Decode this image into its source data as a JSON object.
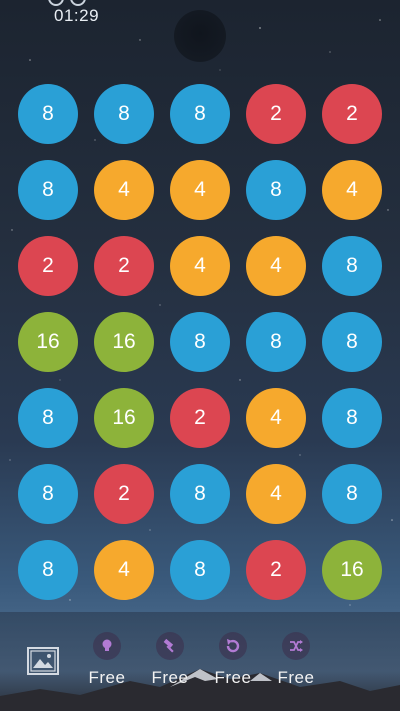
{
  "status": {
    "timer": "01:29"
  },
  "board": {
    "rows": [
      [
        8,
        8,
        8,
        2,
        2
      ],
      [
        8,
        4,
        4,
        8,
        4
      ],
      [
        2,
        2,
        4,
        4,
        8
      ],
      [
        16,
        16,
        8,
        8,
        8
      ],
      [
        8,
        16,
        2,
        4,
        8
      ],
      [
        8,
        2,
        8,
        4,
        8
      ],
      [
        8,
        4,
        8,
        2,
        16
      ]
    ],
    "colors": {
      "2": "#dc4651",
      "4": "#f6a92d",
      "8": "#2aa0d6",
      "16": "#8db33a"
    }
  },
  "toolbar": {
    "gallery_icon": "gallery-icon",
    "powerups": [
      {
        "icon": "lightbulb-icon",
        "label": "Free"
      },
      {
        "icon": "hammer-icon",
        "label": "Free"
      },
      {
        "icon": "undo-icon",
        "label": "Free"
      },
      {
        "icon": "shuffle-icon",
        "label": "Free"
      }
    ]
  }
}
